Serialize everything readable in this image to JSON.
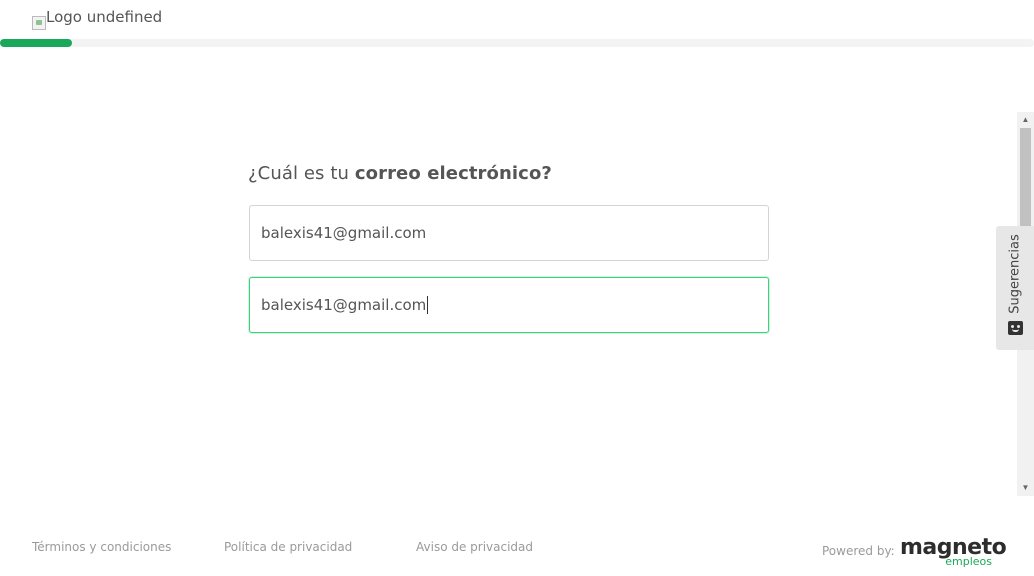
{
  "header": {
    "logo_alt": "Logo undefined"
  },
  "progress": {
    "fraction": 0.07,
    "color": "#1aa85a"
  },
  "form": {
    "question_prefix": "¿Cuál es tu ",
    "question_bold": "correo electrónico?",
    "email_value": "balexis41@gmail.com",
    "email_confirm_value": "balexis41@gmail.com"
  },
  "feedback": {
    "label": "Sugerencias",
    "icon": "smiley-face-icon"
  },
  "footer": {
    "terms": "Términos y condiciones",
    "privacy_policy": "Política de privacidad",
    "privacy_notice": "Aviso de privacidad",
    "powered_by": "Powered by:",
    "brand_main": "magneto",
    "brand_sub": "empleos"
  },
  "colors": {
    "accent": "#1aa85a",
    "focus_border": "#3ed37a"
  }
}
